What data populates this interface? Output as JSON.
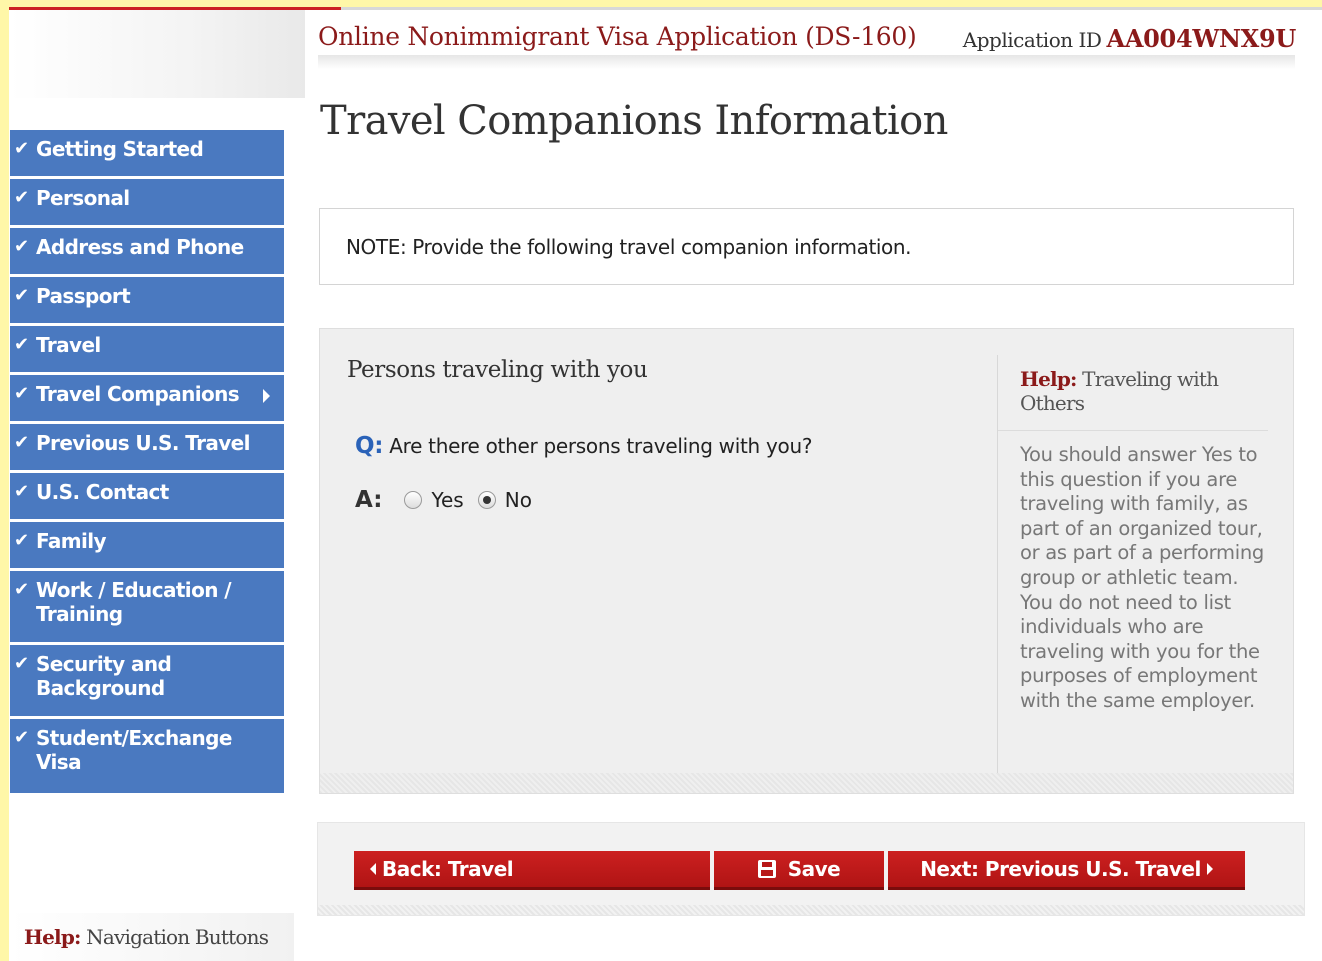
{
  "header": {
    "title": "Online Nonimmigrant Visa Application (DS-160)",
    "app_id_label": "Application ID",
    "app_id_value": "AA004WNX9U"
  },
  "page_title": "Travel Companions Information",
  "sidebar": {
    "items": [
      {
        "label": "Getting Started",
        "completed": true
      },
      {
        "label": "Personal",
        "completed": true
      },
      {
        "label": "Address and Phone",
        "completed": true
      },
      {
        "label": "Passport",
        "completed": true
      },
      {
        "label": "Travel",
        "completed": true
      },
      {
        "label": "Travel Companions",
        "completed": true,
        "current": true
      },
      {
        "label": "Previous U.S. Travel",
        "completed": true
      },
      {
        "label": "U.S. Contact",
        "completed": true
      },
      {
        "label": "Family",
        "completed": true
      },
      {
        "label_line1": "Work / Education /",
        "label_line2": "Training",
        "completed": true
      },
      {
        "label_line1": "Security and",
        "label_line2": "Background",
        "completed": true
      },
      {
        "label_line1": "Student/Exchange",
        "label_line2": "Visa",
        "completed": true
      }
    ],
    "help_word": "Help:",
    "help_text": "Navigation Buttons"
  },
  "note": "NOTE: Provide the following travel companion information.",
  "section": {
    "heading": "Persons traveling with you",
    "q_label": "Q:",
    "question": "Are there other persons traveling with you?",
    "a_label": "A:",
    "options": [
      {
        "label": "Yes",
        "selected": false
      },
      {
        "label": "No",
        "selected": true
      }
    ]
  },
  "help_panel": {
    "help_word": "Help:",
    "title": "Traveling with Others",
    "body": "You should answer Yes to this question if you are traveling with family, as part of an organized tour, or as part of a performing group or athletic team. You do not need to list individuals who are traveling with you for the purposes of employment with the same employer."
  },
  "buttons": {
    "back": "Back: Travel",
    "save": "Save",
    "next": "Next: Previous U.S. Travel"
  },
  "colors": {
    "nav_blue": "#4a79c0",
    "brand_red": "#8b1a1a",
    "button_red": "#c41a1a",
    "question_blue": "#2a62b8"
  }
}
